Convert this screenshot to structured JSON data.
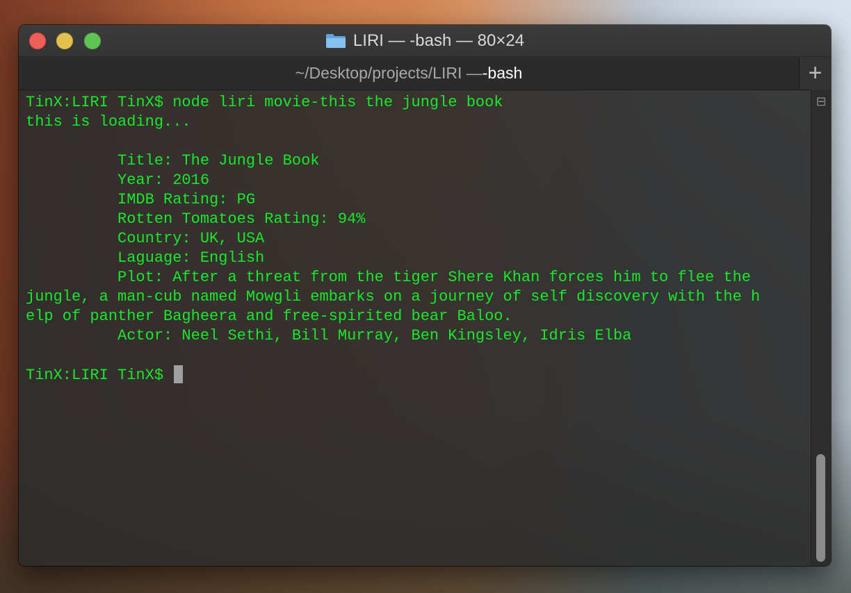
{
  "window": {
    "title": "LIRI — -bash — 80×24",
    "folder_icon": "folder-icon"
  },
  "tab": {
    "path": "~/Desktop/projects/LIRI —",
    "process": " -bash",
    "new_tab_label": "+"
  },
  "terminal": {
    "lines": [
      "TinX:LIRI TinX$ node liri movie-this the jungle book",
      "this is loading...",
      "",
      "          Title: The Jungle Book",
      "          Year: 2016",
      "          IMDB Rating: PG",
      "          Rotten Tomatoes Rating: 94%",
      "          Country: UK, USA",
      "          Laguage: English",
      "          Plot: After a threat from the tiger Shere Khan forces him to flee the",
      "jungle, a man-cub named Mowgli embarks on a journey of self discovery with the h",
      "elp of panther Bagheera and free-spirited bear Baloo.",
      "          Actor: Neel Sethi, Bill Murray, Ben Kingsley, Idris Elba",
      ""
    ],
    "prompt": "TinX:LIRI TinX$ "
  },
  "colors": {
    "terminal_text": "#18e82a",
    "close": "#ee5f58",
    "minimize": "#e2c24c",
    "maximize": "#5fc454"
  },
  "scrollbar": {
    "button_icon": "list-icon",
    "button_glyph": "⊟"
  }
}
